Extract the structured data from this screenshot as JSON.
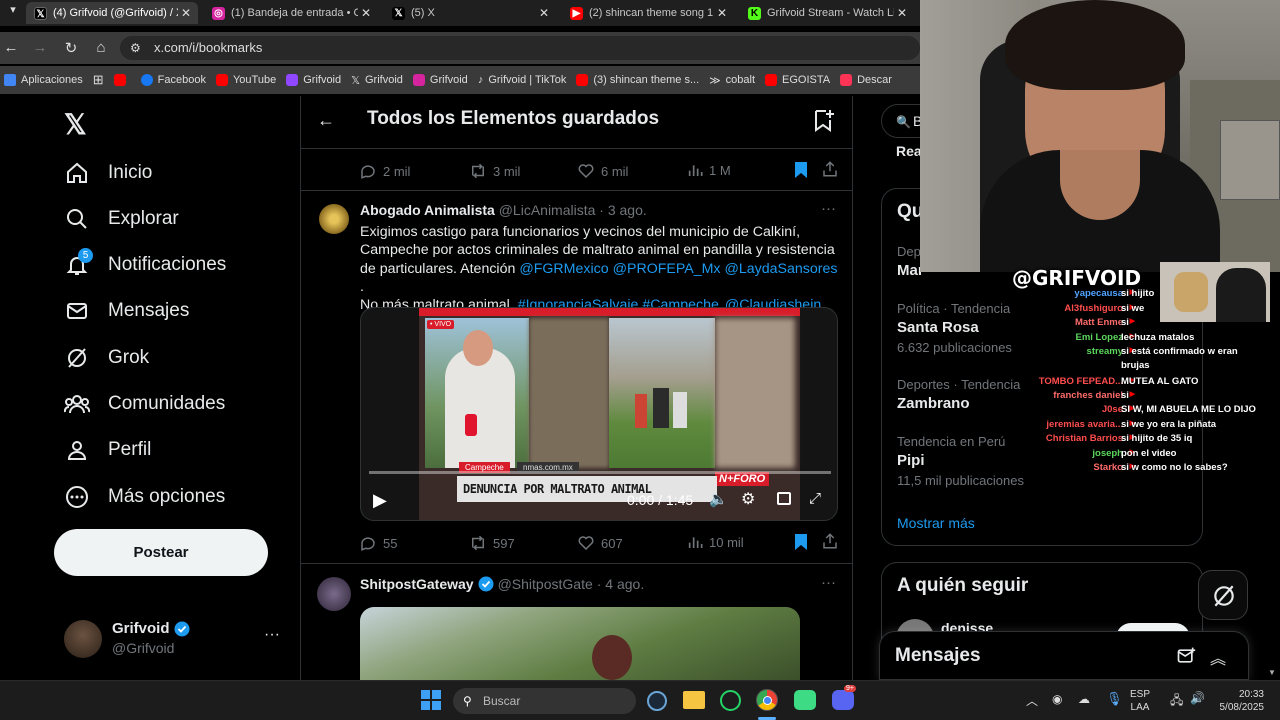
{
  "browser": {
    "tabs": [
      {
        "label": "(4) Grifvoid (@Grifvoid) / X",
        "icon": "x-logo-icon",
        "color": "#000000"
      },
      {
        "label": "(1) Bandeja de entrada • C",
        "icon": "instagram-icon",
        "color": "#d6249f"
      },
      {
        "label": "(5) X",
        "icon": "x-logo-icon",
        "color": "#000000"
      },
      {
        "label": "(2) shincan theme song 1",
        "icon": "youtube-icon",
        "color": "#ff0000"
      },
      {
        "label": "Grifvoid Stream - Watch Li",
        "icon": "kick-icon",
        "color": "#53fc18"
      }
    ],
    "url": "x.com/i/bookmarks",
    "bookmarks": [
      {
        "label": "Aplicaciones",
        "icon": "apps-grid-icon",
        "color": "#dddddd"
      },
      {
        "label": "",
        "icon": "youtube-icon",
        "color": "#ff0000"
      },
      {
        "label": "Facebook",
        "icon": "facebook-icon",
        "color": "#1877f2"
      },
      {
        "label": "YouTube",
        "icon": "youtube-icon",
        "color": "#ff0000"
      },
      {
        "label": "Grifvoid",
        "icon": "twitch-icon",
        "color": "#9146ff"
      },
      {
        "label": "Grifvoid",
        "icon": "x-logo-icon",
        "color": "#ffffff"
      },
      {
        "label": "Grifvoid",
        "icon": "instagram-icon",
        "color": "#d6249f"
      },
      {
        "label": "Grifvoid | TikTok",
        "icon": "tiktok-icon",
        "color": "#ffffff"
      },
      {
        "label": "(3) shincan theme s...",
        "icon": "youtube-icon",
        "color": "#ff0000"
      },
      {
        "label": "cobalt",
        "icon": "cobalt-icon",
        "color": "#ffffff"
      },
      {
        "label": "EGOISTA",
        "icon": "youtube-icon",
        "color": "#ff0000"
      },
      {
        "label": "Descar",
        "icon": "download-icon",
        "color": "#ff3355"
      }
    ]
  },
  "sidebar": {
    "items": [
      {
        "label": "Inicio",
        "icon": "home-icon"
      },
      {
        "label": "Explorar",
        "icon": "search-icon"
      },
      {
        "label": "Notificaciones",
        "icon": "bell-icon",
        "badge": "5"
      },
      {
        "label": "Mensajes",
        "icon": "mail-icon"
      },
      {
        "label": "Grok",
        "icon": "grok-icon"
      },
      {
        "label": "Comunidades",
        "icon": "communities-icon"
      },
      {
        "label": "Perfil",
        "icon": "profile-icon"
      },
      {
        "label": "Más opciones",
        "icon": "more-circle-icon"
      }
    ],
    "post_label": "Postear",
    "account": {
      "name": "Grifvoid",
      "handle": "@Grifvoid"
    }
  },
  "main": {
    "title": "Todos los Elementos guardados",
    "prev_actions": {
      "replies": "2 mil",
      "reposts": "3 mil",
      "likes": "6 mil",
      "views": "1 M"
    },
    "tweet1": {
      "author": "Abogado Animalista",
      "handle": "@LicAnimalista",
      "date": "· 3 ago.",
      "text_plain1": "Exigimos castigo para funcionarios y vecinos del municipio de Calkiní, Campeche por actos criminales de maltrato animal en pandilla y resistencia de particulares. Atención",
      "m1": "@FGRMexico",
      "m2": "@PROFEPA_Mx",
      "m3": "@LaydaSansores",
      "text_plain2": ".",
      "text_plain3": "No más maltrato animal.",
      "h1": "#IgnoranciaSalvaje",
      "h2": "#Campeche",
      "m4": "@Claudiashein",
      "video": {
        "live_tag": "• VIVO",
        "location": "Campeche",
        "site": "nmas.com.mx",
        "headline": "DENUNCIA POR MALTRATO ANIMAL",
        "brand": "N+FORO",
        "time": "0:00 / 1:45",
        "progress": 0
      },
      "actions": {
        "replies": "55",
        "reposts": "597",
        "likes": "607",
        "views": "10 mil"
      }
    },
    "tweet2": {
      "author": "ShitpostGateway",
      "handle": "@ShitpostGate",
      "date": "· 4 ago."
    }
  },
  "right": {
    "search_partial": "B",
    "top_partial": "Rea",
    "trends_title_partial": "Qu",
    "trend0": {
      "context": "Depo",
      "name": "Mar"
    },
    "trends": [
      {
        "context": "Política · Tendencia",
        "name": "Santa Rosa",
        "count": "6.632 publicaciones"
      },
      {
        "context": "Deportes · Tendencia",
        "name": "Zambrano",
        "count": ""
      },
      {
        "context": "Tendencia en Perú",
        "name": "Pipi",
        "count": "11,5 mil publicaciones"
      }
    ],
    "show_more": "Mostrar más",
    "follow_title": "A quién seguir",
    "follow_first": "denisse",
    "messages_title": "Mensajes"
  },
  "overlay": {
    "streamer_tag": "@GRIFVOID",
    "chat": [
      {
        "user": "yapecausa",
        "msg": "si hijito",
        "color": "#4fa3ff"
      },
      {
        "user": "Al3fushiguro",
        "msg": "si we",
        "color": "#ff4d4d"
      },
      {
        "user": "Matt Enme",
        "msg": "si",
        "color": "#ff6b6b"
      },
      {
        "user": "Emi Lopez",
        "msg": "lechuza matalos",
        "color": "#5cd65c"
      },
      {
        "user": "streamy",
        "msg": "si está confirmado w eran",
        "msg2": "brujas",
        "color": "#5cd65c"
      },
      {
        "user": "TOMBO FEPEAD...",
        "msg": "MUTEA AL GATO",
        "color": "#ff4d4d"
      },
      {
        "user": "franches daniel",
        "msg": "si",
        "color": "#ff6b6b"
      },
      {
        "user": "J0se",
        "msg": "SI W, MI ABUELA ME LO DIJO",
        "color": "#ff4d4d"
      },
      {
        "user": "jeremias avaria...",
        "msg": "si we yo era la piñata",
        "color": "#ff4d4d"
      },
      {
        "user": "Christian Barrios",
        "msg": "si hijito de 35 iq",
        "color": "#ff4d4d"
      },
      {
        "user": "joseph",
        "msg": "pon el video",
        "color": "#5cd65c"
      },
      {
        "user": "Starko",
        "msg": "si w como no lo sabes?",
        "color": "#ff6b6b"
      }
    ]
  },
  "taskbar": {
    "search_placeholder": "Buscar",
    "lang1": "ESP",
    "lang2": "LAA",
    "time": "20:33",
    "date": "5/08/2025",
    "discord_badge": "9+"
  }
}
